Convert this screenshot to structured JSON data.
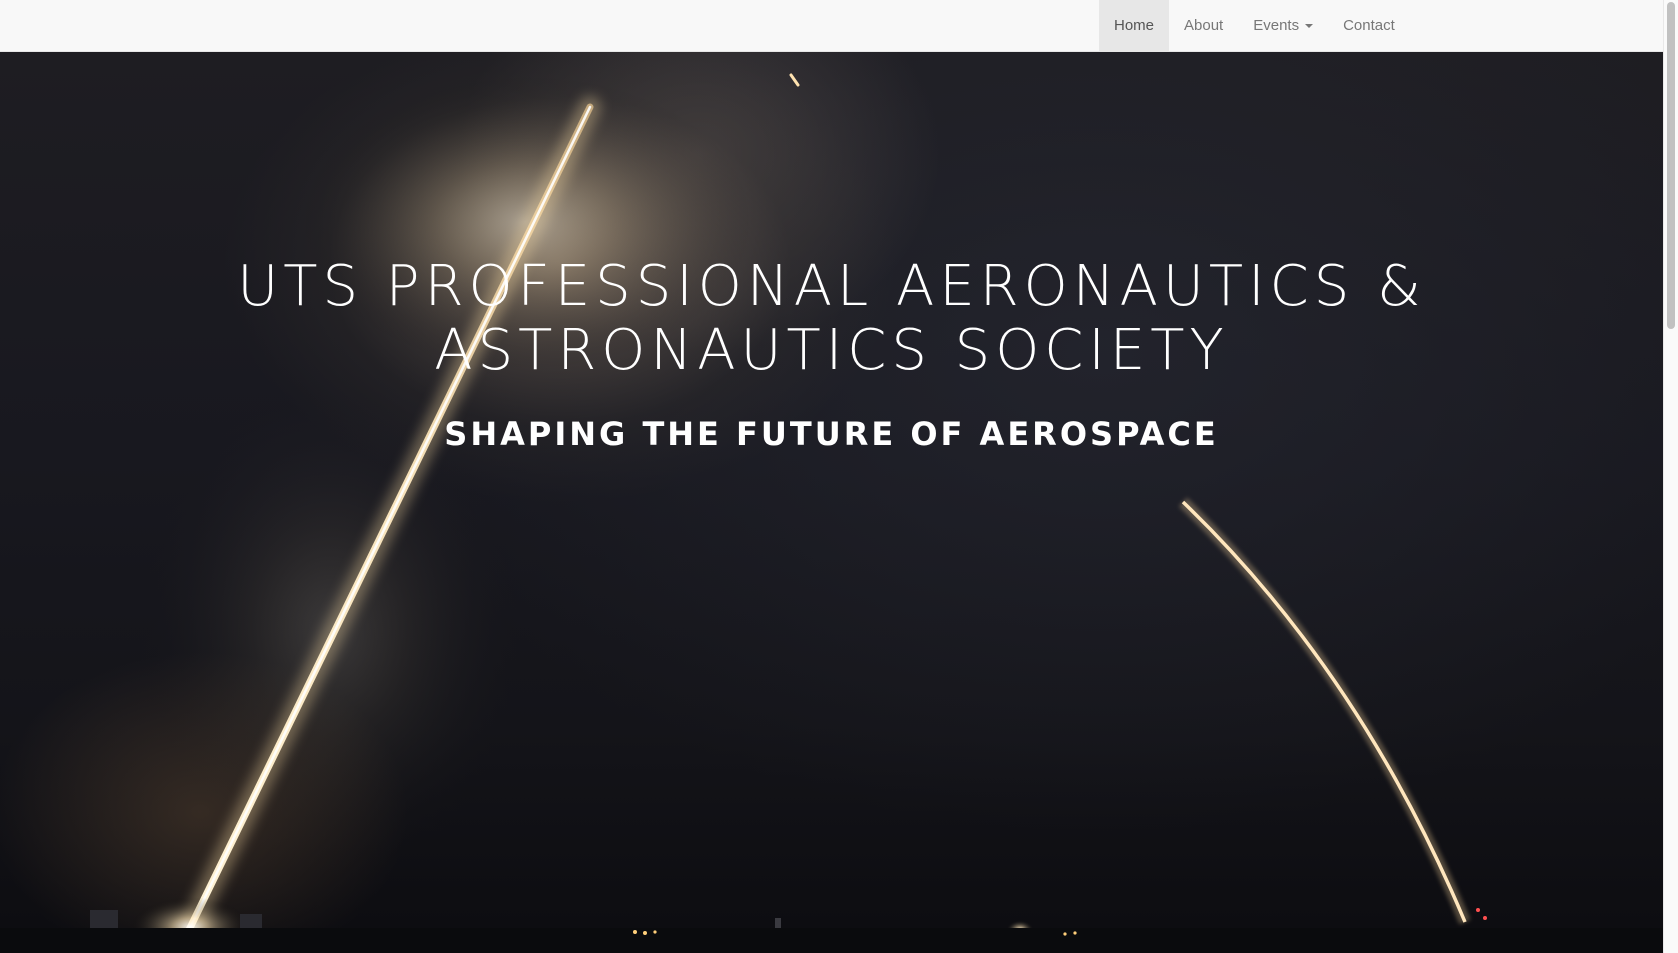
{
  "navbar": {
    "items": [
      {
        "label": "Home",
        "active": true
      },
      {
        "label": "About",
        "active": false
      },
      {
        "label": "Events",
        "active": false,
        "has_dropdown": true
      },
      {
        "label": "Contact",
        "active": false
      }
    ]
  },
  "hero": {
    "title_line1": "UTS PROFESSIONAL AERONAUTICS &",
    "title_line2": "ASTRONAUTICS SOCIETY",
    "subtitle": "SHAPING THE FUTURE OF AEROSPACE",
    "background": "night sky rocket launch long-exposure photo"
  },
  "colors": {
    "navbar_bg": "#f8f8f8",
    "nav_active_bg": "#e7e7e7",
    "nav_text": "#777777",
    "hero_text": "#ffffff"
  }
}
